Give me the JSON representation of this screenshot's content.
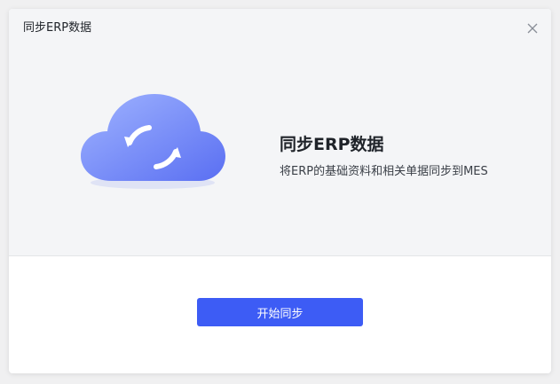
{
  "dialog": {
    "title": "同步ERP数据",
    "close_icon": "close-icon"
  },
  "sync_info": {
    "illustration_icon": "cloud-sync-icon",
    "heading": "同步ERP数据",
    "description": "将ERP的基础资料和相关单据同步到MES"
  },
  "footer": {
    "start_button_label": "开始同步"
  },
  "colors": {
    "accent": "#3d5cf5",
    "cloud_light": "#8ea6ff",
    "cloud_dark": "#5b6ef0",
    "panel_bg": "#f4f5f7"
  }
}
